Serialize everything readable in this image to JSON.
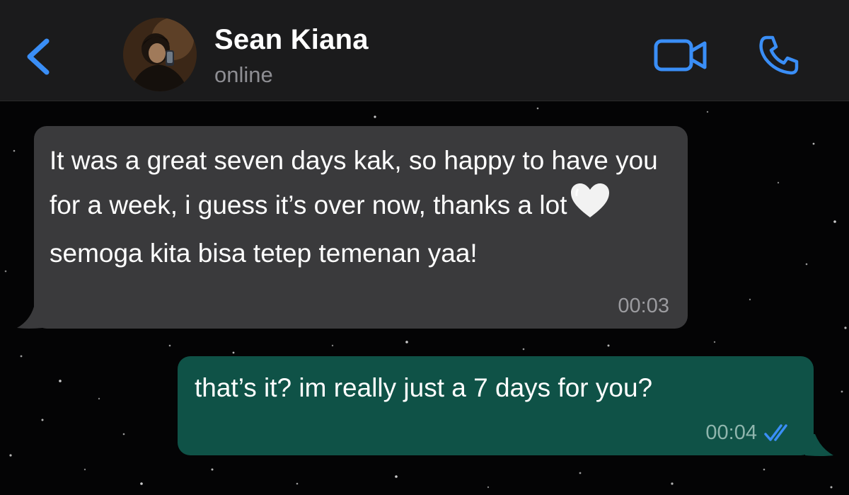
{
  "header": {
    "contact_name": "Sean Kiana",
    "status": "online",
    "back_icon": "chevron-left-icon",
    "video_icon": "video-camera-icon",
    "call_icon": "phone-icon",
    "accent_color": "#3a8ef6",
    "background_color": "#1b1b1c"
  },
  "messages": [
    {
      "direction": "incoming",
      "text_before_emoji": "It was a great seven days kak, so happy to have you for a week, i guess it’s over now, thanks a lot",
      "emoji": "white-heart-icon",
      "text_after_emoji": "semoga kita bisa tetep temenan yaa!",
      "time": "00:03",
      "bubble_color": "#3a3a3c"
    },
    {
      "direction": "outgoing",
      "text": "that’s it? im really just a 7 days for you?",
      "time": "00:04",
      "status_icon": "double-check-icon",
      "bubble_color": "#0f5247"
    }
  ]
}
